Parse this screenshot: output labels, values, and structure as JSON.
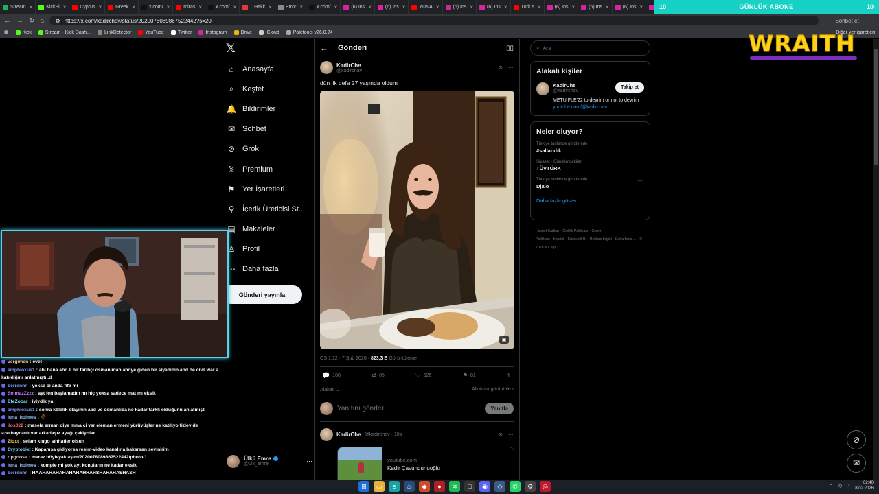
{
  "browser": {
    "tabs": [
      {
        "label": "Stream",
        "color": "#1bb35c"
      },
      {
        "label": "KickSi",
        "color": "#53fc18"
      },
      {
        "label": "Cyprus",
        "color": "#ff0000"
      },
      {
        "label": "Greek",
        "color": "#ff0000"
      },
      {
        "label": "x.com/",
        "color": "#111111"
      },
      {
        "label": "miras",
        "color": "#ff0000"
      },
      {
        "label": "x.com/",
        "color": "#111111"
      },
      {
        "label": "İ. Hakk",
        "color": "#e23a3a"
      },
      {
        "label": "Error",
        "color": "#8a8a8a"
      },
      {
        "label": "x.com/",
        "color": "#111111"
      },
      {
        "label": "(6) Ins",
        "color": "#d6249f"
      },
      {
        "label": "(6) Ins",
        "color": "#d6249f"
      },
      {
        "label": "YUNA",
        "color": "#ff0000"
      },
      {
        "label": "(6) Ins",
        "color": "#d6249f"
      },
      {
        "label": "(6) Ins",
        "color": "#d6249f"
      },
      {
        "label": "Türk s",
        "color": "#ff0000"
      },
      {
        "label": "(6) Ins",
        "color": "#d6249f"
      },
      {
        "label": "(6) Ins",
        "color": "#d6249f"
      },
      {
        "label": "(6) Ins",
        "color": "#d6249f"
      },
      {
        "label": "(6) Ins",
        "color": "#d6249f"
      }
    ],
    "url": "https://x.com/kadirchav/status/2020078089867522442?s=20",
    "profile_label": "Sohbet et",
    "bookmarks": [
      {
        "label": "Kick",
        "color": "#53fc18"
      },
      {
        "label": "Stream - Kick Dash...",
        "color": "#53fc18"
      },
      {
        "label": "LinkDetector",
        "color": "#888888"
      },
      {
        "label": "YouTube",
        "color": "#ff0000"
      },
      {
        "label": "Twitter",
        "color": "#ffffff"
      },
      {
        "label": "Instagram",
        "color": "#d6249f"
      },
      {
        "label": "Drive",
        "color": "#f4b400"
      },
      {
        "label": "iCloud",
        "color": "#cccccc"
      },
      {
        "label": "Paletools v26.0.24",
        "color": "#aaaaaa"
      }
    ],
    "other_bookmarks": "Diğer yer işaretleri"
  },
  "sub_banner": {
    "left_num": "10",
    "title": "GÜNLÜK ABONE",
    "right_num": "10"
  },
  "nav": {
    "items": [
      {
        "label": "Anasayfa",
        "icon": "home-icon",
        "glyph": "⌂"
      },
      {
        "label": "Keşfet",
        "icon": "search-icon",
        "glyph": "⌕"
      },
      {
        "label": "Bildirimler",
        "icon": "bell-icon",
        "glyph": "🔔"
      },
      {
        "label": "Sohbet",
        "icon": "mail-icon",
        "glyph": "✉"
      },
      {
        "label": "Grok",
        "icon": "grok-icon",
        "glyph": "⊘"
      },
      {
        "label": "Premium",
        "icon": "x-premium-icon",
        "glyph": "𝕏"
      },
      {
        "label": "Yer İşaretleri",
        "icon": "bookmark-icon",
        "glyph": "⚑"
      },
      {
        "label": "İçerik Üreticisi St...",
        "icon": "creator-studio-icon",
        "glyph": "⚲"
      },
      {
        "label": "Makaleler",
        "icon": "articles-icon",
        "glyph": "▤"
      },
      {
        "label": "Profil",
        "icon": "profile-icon",
        "glyph": "♙"
      },
      {
        "label": "Daha fazla",
        "icon": "more-circle-icon",
        "glyph": "⋯"
      }
    ],
    "post_button": "Gönderi yayınla",
    "account": {
      "name": "Ülkü Emre",
      "handle": "@ulk_emre"
    }
  },
  "main": {
    "header_title": "Gönderi",
    "tweet": {
      "author_name": "KadirChe",
      "author_handle": "@kadirchav",
      "text": "dün ilk defa 27 yaşında oldum",
      "time": "ÖS 1:12 · 7 Şub 2026 · ",
      "views_count": "823,3 B",
      "views_label": " Görüntüleme",
      "replies": "108",
      "retweets": "85",
      "likes": "526",
      "bookmarks": "81",
      "sort_label": "Alakalı",
      "quotes_label": "Alıntıları görüntüle"
    },
    "reply_placeholder": "Yanıtını gönder",
    "reply_button": "Yanıtla",
    "reply": {
      "author_name": "KadirChe",
      "meta": "@kadirchav · 10s",
      "card_domain": "youtube.com",
      "card_title": "Kadir Çavundurluoğlu"
    }
  },
  "right": {
    "search_placeholder": "Ara",
    "people_title": "Alakalı kişiler",
    "person": {
      "name": "KadirChe",
      "handle": "@kadirchav",
      "follow": "Takip et",
      "bio": "METU FLE'22 to devrim or not to devrim ",
      "bio_link": "youtube.com/@kadirchav"
    },
    "trends_title": "Neler oluyor?",
    "trends": [
      {
        "context": "Türkiye tarihinde gündemde",
        "name": "#sallandık"
      },
      {
        "context": "Siyaset · Gündemdekiler",
        "name": "TÜVTÜRK"
      },
      {
        "context": "Türkiye tarihinde gündemde",
        "name": "Djalo"
      }
    ],
    "show_more": "Daha fazla göster",
    "footer": [
      "Hizmet Şartları",
      "Gizlilik Politikası",
      "Çerez Politikası",
      "Imprint",
      "Erişilebilirlik",
      "Reklam bilgisi",
      "Daha fazla ...",
      "© 2026 X Corp."
    ]
  },
  "overlay": {
    "logo": "WRAITH",
    "chat": [
      {
        "user": "vergimen",
        "text": ": evet",
        "color": "#f0c0a0"
      },
      {
        "user": "amphioxus1",
        "text": ": abi bana abd li bir tarihçi osmanlıdan abdye giden bir siyahinin abd de civil war a katıldığını anlatmıştı .d",
        "color": "#7b9cff"
      },
      {
        "user": "berrennn",
        "text": ": yoksa bi anda fifa mi",
        "color": "#7b9cff"
      },
      {
        "user": "SolmazZzzz",
        "text": ": ayt fen başlamadın mı hiç yoksa sadece mat mı eksik",
        "color": "#c77dff"
      },
      {
        "user": "EfeZobar",
        "text": ": iyiydik ya",
        "color": "#7bdcff"
      },
      {
        "user": "amphioxus1",
        "text": ": sonra kölelik olayının abd ve osmanlıda ne kadar farklı olduğunu anlatmıştı",
        "color": "#7b9cff"
      },
      {
        "user": "luna_holmes",
        "text": ": 🥀",
        "color": "#a0c4ff"
      },
      {
        "user": "ilos022",
        "text": ": mesela arman diye mma ci var eleman ermeni yürüyüşlerine katılıyo fiziev de azerbaycanlı var arkadaşız ayağı çekiyolar",
        "color": "#ff6b6b"
      },
      {
        "user": "Zioxt",
        "text": ": selam kingo sıhhatler olsun",
        "color": "#ffd166"
      },
      {
        "user": "Cryptobixi",
        "text": ": Kapanışa gidiyorsa resim-video kanalına bakarsan sevinirim",
        "color": "#7bdcff"
      },
      {
        "user": "ripgoose",
        "text": ": meraz böyleyaklaşım/2020078089867522442/photo/1",
        "color": "#cccccc"
      },
      {
        "user": "luna_holmes",
        "text": ": komple mi yok ayt konuların ne kadar eksik",
        "color": "#a0c4ff"
      },
      {
        "user": "berrennn",
        "text": ": HAAHAHAHAHAHAHAHHAHSHAHAHASHASH",
        "color": "#7b9cff"
      }
    ]
  },
  "taskbar": {
    "time": "02:40",
    "date": "8.02.2026"
  }
}
